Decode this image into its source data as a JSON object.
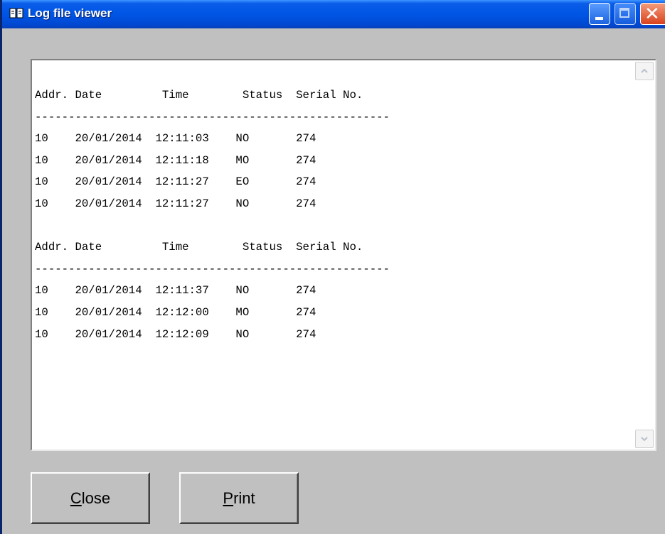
{
  "window": {
    "title": "Log file viewer",
    "icon": "book-icon"
  },
  "titlebar_buttons": [
    "minimize",
    "maximize",
    "close"
  ],
  "log": {
    "lines": [
      "Addr. Date         Time        Status  Serial No.",
      "-----------------------------------------------------",
      "10    20/01/2014  12:11:03    NO       274",
      "10    20/01/2014  12:11:18    MO       274",
      "10    20/01/2014  12:11:27    EO       274",
      "10    20/01/2014  12:11:27    NO       274",
      "",
      "Addr. Date         Time        Status  Serial No.",
      "-----------------------------------------------------",
      "10    20/01/2014  12:11:37    NO       274",
      "10    20/01/2014  12:12:00    MO       274",
      "10    20/01/2014  12:12:09    NO       274"
    ]
  },
  "buttons": {
    "close": {
      "accel": "C",
      "rest": "lose"
    },
    "print": {
      "accel": "P",
      "rest": "rint"
    }
  },
  "colors": {
    "titlebar": "#0055e5",
    "face": "#c0c0c0",
    "close_button": "#d9421d"
  }
}
